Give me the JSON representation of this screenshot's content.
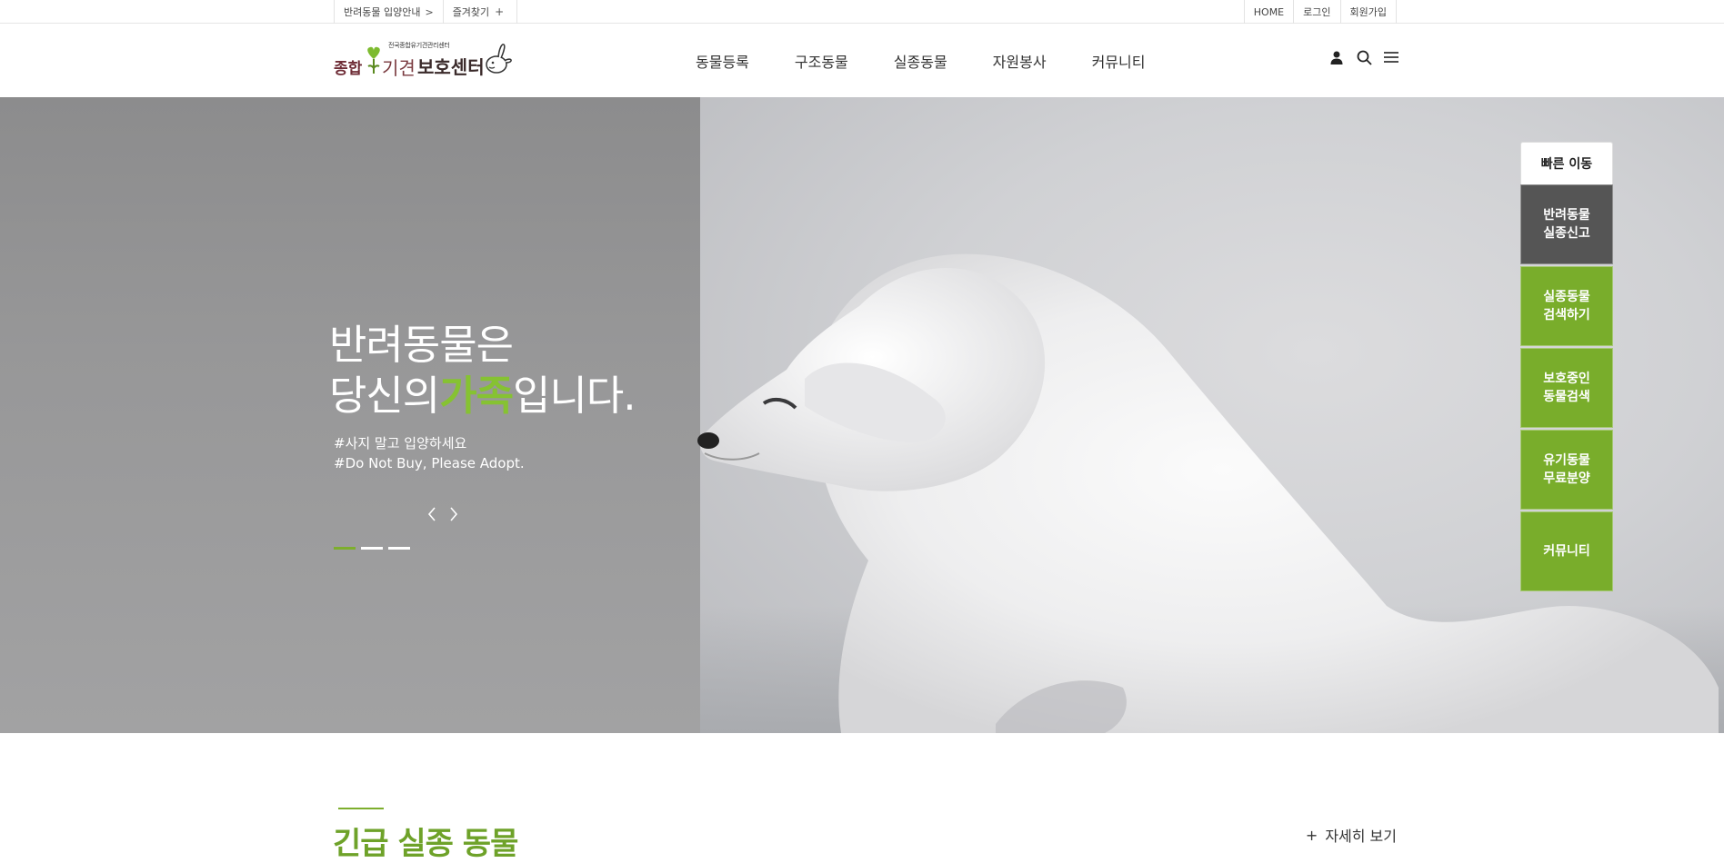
{
  "topbar": {
    "left": [
      {
        "label": "반려동물 입양안내",
        "icon": "chevron-right-icon"
      },
      {
        "label": "즐겨찾기",
        "icon": "plus-icon"
      }
    ],
    "right": [
      "HOME",
      "로그인",
      "회원가입"
    ]
  },
  "logo": {
    "subtitle": "전국종합유기견관리센터",
    "word1": "종합",
    "word2": "기견",
    "word3": "보호센터",
    "icon": "rabbit-mascot-icon"
  },
  "gnb": [
    "동물등록",
    "구조동물",
    "실종동물",
    "자원봉사",
    "커뮤니티"
  ],
  "util_icons": [
    "user-icon",
    "search-icon",
    "menu-icon"
  ],
  "hero": {
    "line1": "반려동물은",
    "line2_pre": "당신의",
    "line2_highlight": "가족",
    "line2_post": "입니다.",
    "tag1": "#사지 말고 입양하세요",
    "tag2": "#Do Not Buy, Please Adopt.",
    "prev": "‹",
    "next": "›",
    "slides": 3,
    "active_slide": 1,
    "highlight_color": "#86c232"
  },
  "quick_menu": {
    "title": "빠른 이동",
    "items": [
      {
        "line1": "반려동물",
        "line2": "실종신고",
        "style": "dark"
      },
      {
        "line1": "실종동물",
        "line2": "검색하기",
        "style": "green"
      },
      {
        "line1": "보호중인",
        "line2": "동물검색",
        "style": "green"
      },
      {
        "line1": "유기동물",
        "line2": "무료분양",
        "style": "green"
      },
      {
        "line1": "커뮤니티",
        "line2": "",
        "style": "green"
      }
    ],
    "colors": {
      "dark": "#555555",
      "green": "#79ad2b"
    }
  },
  "section": {
    "title": "긴급 실종 동물",
    "more_icon": "+",
    "more_label": "자세히 보기",
    "accent": "#6ea229"
  }
}
